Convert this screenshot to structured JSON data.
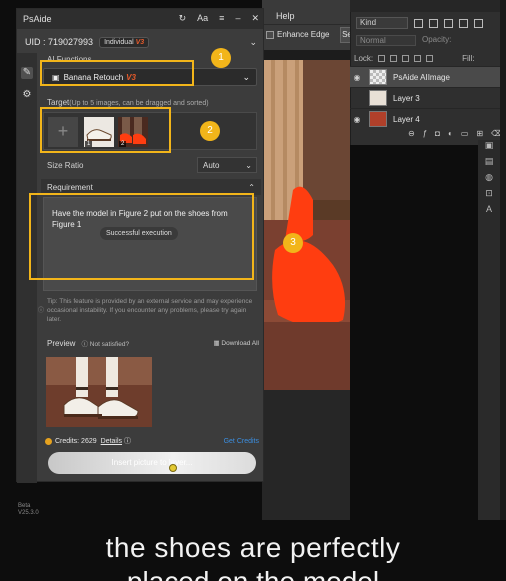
{
  "photoshop": {
    "menu_help": "Help",
    "enhance_edge": "Enhance Edge",
    "se_button": "Se",
    "layers": {
      "kind": "Kind",
      "blend_mode": "Normal",
      "opacity_label": "Opacity:",
      "lock_label": "Lock:",
      "fill_label": "Fill:",
      "rows": [
        {
          "name": "PsAide AIImage",
          "visible": true,
          "selected": true
        },
        {
          "name": "Layer 3",
          "visible": false,
          "selected": false
        },
        {
          "name": "Layer 4",
          "visible": true,
          "selected": false
        }
      ]
    }
  },
  "plugin": {
    "title": "PsAide",
    "uid": "UID : 719027993",
    "plan": "Individual",
    "plan_version": "V3",
    "ai_functions_label": "AI Functions",
    "function_name": "Banana Retouch",
    "function_version": "V3",
    "target_label": "Target",
    "target_hint": "(Up to 5 images, can be dragged and sorted)",
    "target_slots": [
      "1",
      "2"
    ],
    "size_ratio_label": "Size Ratio",
    "size_ratio_value": "Auto",
    "requirement_label": "Requirement",
    "requirement_text": "Have the model in Figure 2 put on the shoes from Figure 1",
    "toast": "Successful execution",
    "tip": "Tip: This feature is provided by an external service and may experience occasional instability. If you encounter any problems, please try again later.",
    "preview_label": "Preview",
    "not_satisfied": "Not satisfied?",
    "download_all": "Download All",
    "credits_label": "Credits: 2629",
    "details": "Details",
    "get_credits": "Get Credits",
    "insert_button": "Insert picture to layer...",
    "beta_line1": "Beta",
    "beta_line2": "V25.3.0"
  },
  "annotations": [
    "1",
    "2",
    "3"
  ],
  "subtitle_line1": "the shoes are perfectly",
  "subtitle_line2": "placed on the model",
  "colors": {
    "highlight": "#f2b51a",
    "accent_version": "#e55a2b",
    "link": "#3b8ee0"
  }
}
